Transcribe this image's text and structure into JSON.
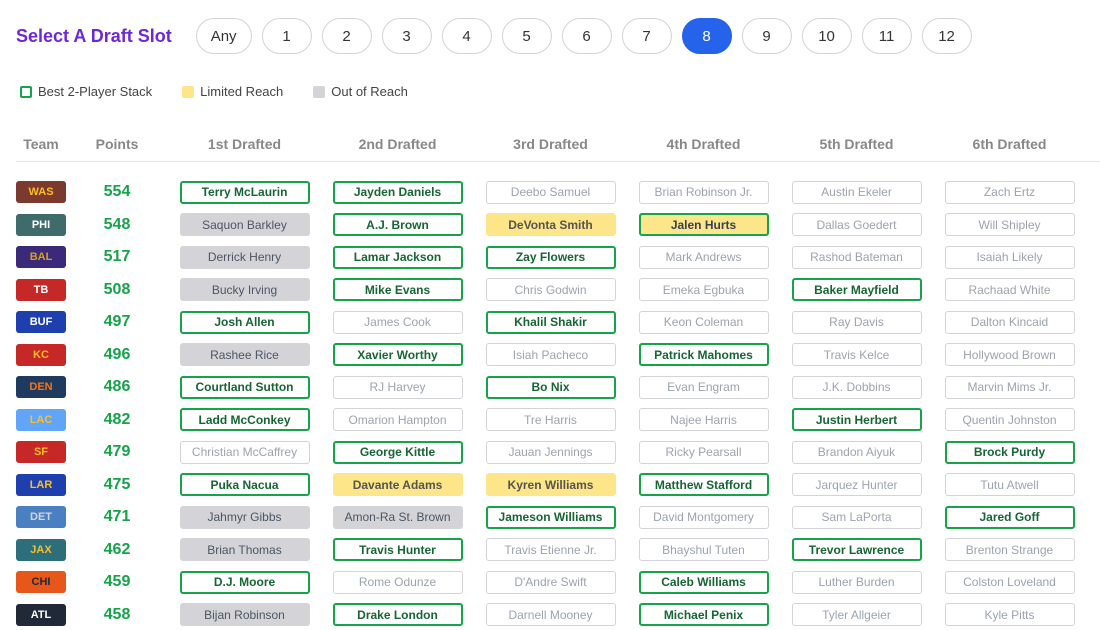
{
  "header": {
    "title": "Select A Draft Slot",
    "slots": [
      "Any",
      "1",
      "2",
      "3",
      "4",
      "5",
      "6",
      "7",
      "8",
      "9",
      "10",
      "11",
      "12"
    ],
    "active_slot": "8"
  },
  "legend": [
    {
      "label": "Best 2-Player Stack",
      "type": "stack"
    },
    {
      "label": "Limited Reach",
      "type": "limited"
    },
    {
      "label": "Out of Reach",
      "type": "out"
    }
  ],
  "table": {
    "columns": [
      "Team",
      "Points",
      "1st Drafted",
      "2nd Drafted",
      "3rd Drafted",
      "4th Drafted",
      "5th Drafted",
      "6th Drafted"
    ],
    "rows": [
      {
        "team": "WAS",
        "bg": "#7c3a2e",
        "fg": "#fbbf24",
        "points": "554",
        "picks": [
          {
            "name": "Terry McLaurin",
            "status": "stack"
          },
          {
            "name": "Jayden Daniels",
            "status": "stack"
          },
          {
            "name": "Deebo Samuel",
            "status": "reach"
          },
          {
            "name": "Brian Robinson Jr.",
            "status": "reach"
          },
          {
            "name": "Austin Ekeler",
            "status": "reach"
          },
          {
            "name": "Zach Ertz",
            "status": "reach"
          }
        ]
      },
      {
        "team": "PHI",
        "bg": "#3f6b6b",
        "fg": "#ffffff",
        "points": "548",
        "picks": [
          {
            "name": "Saquon Barkley",
            "status": "out"
          },
          {
            "name": "A.J. Brown",
            "status": "stack"
          },
          {
            "name": "DeVonta Smith",
            "status": "limited"
          },
          {
            "name": "Jalen Hurts",
            "status": "limited-stack"
          },
          {
            "name": "Dallas Goedert",
            "status": "reach"
          },
          {
            "name": "Will Shipley",
            "status": "reach"
          }
        ]
      },
      {
        "team": "BAL",
        "bg": "#3b2a7a",
        "fg": "#d4a017",
        "points": "517",
        "picks": [
          {
            "name": "Derrick Henry",
            "status": "out"
          },
          {
            "name": "Lamar Jackson",
            "status": "stack"
          },
          {
            "name": "Zay Flowers",
            "status": "stack"
          },
          {
            "name": "Mark Andrews",
            "status": "reach"
          },
          {
            "name": "Rashod Bateman",
            "status": "reach"
          },
          {
            "name": "Isaiah Likely",
            "status": "reach"
          }
        ]
      },
      {
        "team": "TB",
        "bg": "#c62828",
        "fg": "#ffffff",
        "points": "508",
        "picks": [
          {
            "name": "Bucky Irving",
            "status": "out"
          },
          {
            "name": "Mike Evans",
            "status": "stack"
          },
          {
            "name": "Chris Godwin",
            "status": "reach"
          },
          {
            "name": "Emeka Egbuka",
            "status": "reach"
          },
          {
            "name": "Baker Mayfield",
            "status": "stack"
          },
          {
            "name": "Rachaad White",
            "status": "reach"
          }
        ]
      },
      {
        "team": "BUF",
        "bg": "#1e40af",
        "fg": "#ffffff",
        "points": "497",
        "picks": [
          {
            "name": "Josh Allen",
            "status": "stack"
          },
          {
            "name": "James Cook",
            "status": "reach"
          },
          {
            "name": "Khalil Shakir",
            "status": "stack"
          },
          {
            "name": "Keon Coleman",
            "status": "reach"
          },
          {
            "name": "Ray Davis",
            "status": "reach"
          },
          {
            "name": "Dalton Kincaid",
            "status": "reach"
          }
        ]
      },
      {
        "team": "KC",
        "bg": "#c62828",
        "fg": "#fbbf24",
        "points": "496",
        "picks": [
          {
            "name": "Rashee Rice",
            "status": "out"
          },
          {
            "name": "Xavier Worthy",
            "status": "stack"
          },
          {
            "name": "Isiah Pacheco",
            "status": "reach"
          },
          {
            "name": "Patrick Mahomes",
            "status": "stack"
          },
          {
            "name": "Travis Kelce",
            "status": "reach"
          },
          {
            "name": "Hollywood Brown",
            "status": "reach"
          }
        ]
      },
      {
        "team": "DEN",
        "bg": "#1e3a5f",
        "fg": "#f97316",
        "points": "486",
        "picks": [
          {
            "name": "Courtland Sutton",
            "status": "stack"
          },
          {
            "name": "RJ Harvey",
            "status": "reach"
          },
          {
            "name": "Bo Nix",
            "status": "stack"
          },
          {
            "name": "Evan Engram",
            "status": "reach"
          },
          {
            "name": "J.K. Dobbins",
            "status": "reach"
          },
          {
            "name": "Marvin Mims Jr.",
            "status": "reach"
          }
        ]
      },
      {
        "team": "LAC",
        "bg": "#60a5fa",
        "fg": "#fbbf24",
        "points": "482",
        "picks": [
          {
            "name": "Ladd McConkey",
            "status": "stack"
          },
          {
            "name": "Omarion Hampton",
            "status": "reach"
          },
          {
            "name": "Tre Harris",
            "status": "reach"
          },
          {
            "name": "Najee Harris",
            "status": "reach"
          },
          {
            "name": "Justin Herbert",
            "status": "stack"
          },
          {
            "name": "Quentin Johnston",
            "status": "reach"
          }
        ]
      },
      {
        "team": "SF",
        "bg": "#c62828",
        "fg": "#fbbf24",
        "points": "479",
        "picks": [
          {
            "name": "Christian McCaffrey",
            "status": "reach"
          },
          {
            "name": "George Kittle",
            "status": "stack"
          },
          {
            "name": "Jauan Jennings",
            "status": "reach"
          },
          {
            "name": "Ricky Pearsall",
            "status": "reach"
          },
          {
            "name": "Brandon Aiyuk",
            "status": "reach"
          },
          {
            "name": "Brock Purdy",
            "status": "stack"
          }
        ]
      },
      {
        "team": "LAR",
        "bg": "#1e40af",
        "fg": "#fbbf24",
        "points": "475",
        "picks": [
          {
            "name": "Puka Nacua",
            "status": "stack"
          },
          {
            "name": "Davante Adams",
            "status": "limited"
          },
          {
            "name": "Kyren Williams",
            "status": "limited"
          },
          {
            "name": "Matthew Stafford",
            "status": "stack"
          },
          {
            "name": "Jarquez Hunter",
            "status": "reach"
          },
          {
            "name": "Tutu Atwell",
            "status": "reach"
          }
        ]
      },
      {
        "team": "DET",
        "bg": "#4a7fc1",
        "fg": "#d1d5db",
        "points": "471",
        "picks": [
          {
            "name": "Jahmyr Gibbs",
            "status": "out"
          },
          {
            "name": "Amon-Ra St. Brown",
            "status": "out"
          },
          {
            "name": "Jameson Williams",
            "status": "stack"
          },
          {
            "name": "David Montgomery",
            "status": "reach"
          },
          {
            "name": "Sam LaPorta",
            "status": "reach"
          },
          {
            "name": "Jared Goff",
            "status": "stack"
          }
        ]
      },
      {
        "team": "JAX",
        "bg": "#2c6e7a",
        "fg": "#fbbf24",
        "points": "462",
        "picks": [
          {
            "name": "Brian Thomas",
            "status": "out"
          },
          {
            "name": "Travis Hunter",
            "status": "stack"
          },
          {
            "name": "Travis Etienne Jr.",
            "status": "reach"
          },
          {
            "name": "Bhayshul Tuten",
            "status": "reach"
          },
          {
            "name": "Trevor Lawrence",
            "status": "stack"
          },
          {
            "name": "Brenton Strange",
            "status": "reach"
          }
        ]
      },
      {
        "team": "CHI",
        "bg": "#e8571a",
        "fg": "#1e293b",
        "points": "459",
        "picks": [
          {
            "name": "D.J. Moore",
            "status": "stack"
          },
          {
            "name": "Rome Odunze",
            "status": "reach"
          },
          {
            "name": "D'Andre Swift",
            "status": "reach"
          },
          {
            "name": "Caleb Williams",
            "status": "stack"
          },
          {
            "name": "Luther Burden",
            "status": "reach"
          },
          {
            "name": "Colston Loveland",
            "status": "reach"
          }
        ]
      },
      {
        "team": "ATL",
        "bg": "#1f2937",
        "fg": "#ffffff",
        "points": "458",
        "picks": [
          {
            "name": "Bijan Robinson",
            "status": "out"
          },
          {
            "name": "Drake London",
            "status": "stack"
          },
          {
            "name": "Darnell Mooney",
            "status": "reach"
          },
          {
            "name": "Michael Penix",
            "status": "stack"
          },
          {
            "name": "Tyler Allgeier",
            "status": "reach"
          },
          {
            "name": "Kyle Pitts",
            "status": "reach"
          }
        ]
      }
    ]
  }
}
